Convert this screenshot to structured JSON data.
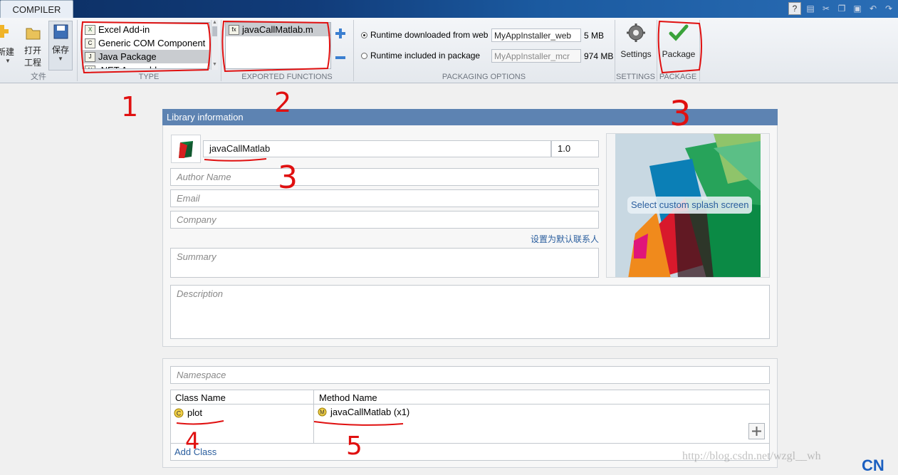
{
  "toolstrip": {
    "tab": "COMPILER",
    "quick_access_icons": [
      "help-icon",
      "save-icon",
      "cut-icon",
      "copy-icon",
      "paste-icon",
      "undo-icon",
      "redo-icon"
    ]
  },
  "file_section": {
    "label": "文件",
    "buttons": {
      "new": "新建",
      "open_line1": "打开",
      "open_line2": "工程",
      "save": "保存"
    }
  },
  "type_section": {
    "label": "TYPE",
    "items": [
      "Excel Add-in",
      "Generic COM Component",
      "Java Package",
      ".NET Assembly"
    ],
    "selected": "Java Package"
  },
  "exported_section": {
    "label": "EXPORTED FUNCTIONS",
    "files": [
      "javaCallMatlab.m"
    ]
  },
  "packaging_section": {
    "label": "PACKAGING OPTIONS",
    "option_web": {
      "label": "Runtime downloaded from web",
      "value": "MyAppInstaller_web",
      "size": "5 MB"
    },
    "option_pkg": {
      "label": "Runtime included in package",
      "value": "MyAppInstaller_mcr",
      "size": "974 MB"
    }
  },
  "settings_section": {
    "label": "SETTINGS",
    "button": "Settings"
  },
  "package_section": {
    "label": "PACKAGE",
    "button": "Package"
  },
  "library": {
    "header": "Library information",
    "name": "javaCallMatlab",
    "version": "1.0",
    "author_placeholder": "Author Name",
    "email_placeholder": "Email",
    "company_placeholder": "Company",
    "default_contact_link": "设置为默认联系人",
    "summary_placeholder": "Summary",
    "description_placeholder": "Description",
    "splash_label": "Select custom splash screen"
  },
  "classes": {
    "namespace_placeholder": "Namespace",
    "col_class": "Class Name",
    "col_method": "Method Name",
    "class_name": "plot",
    "method_name": "javaCallMatlab (x1)",
    "add_class": "Add Class"
  },
  "watermark": "http://blog.csdn.net/wzgl__wh",
  "annotations": [
    "1",
    "2",
    "3",
    "3",
    "4",
    "5"
  ]
}
